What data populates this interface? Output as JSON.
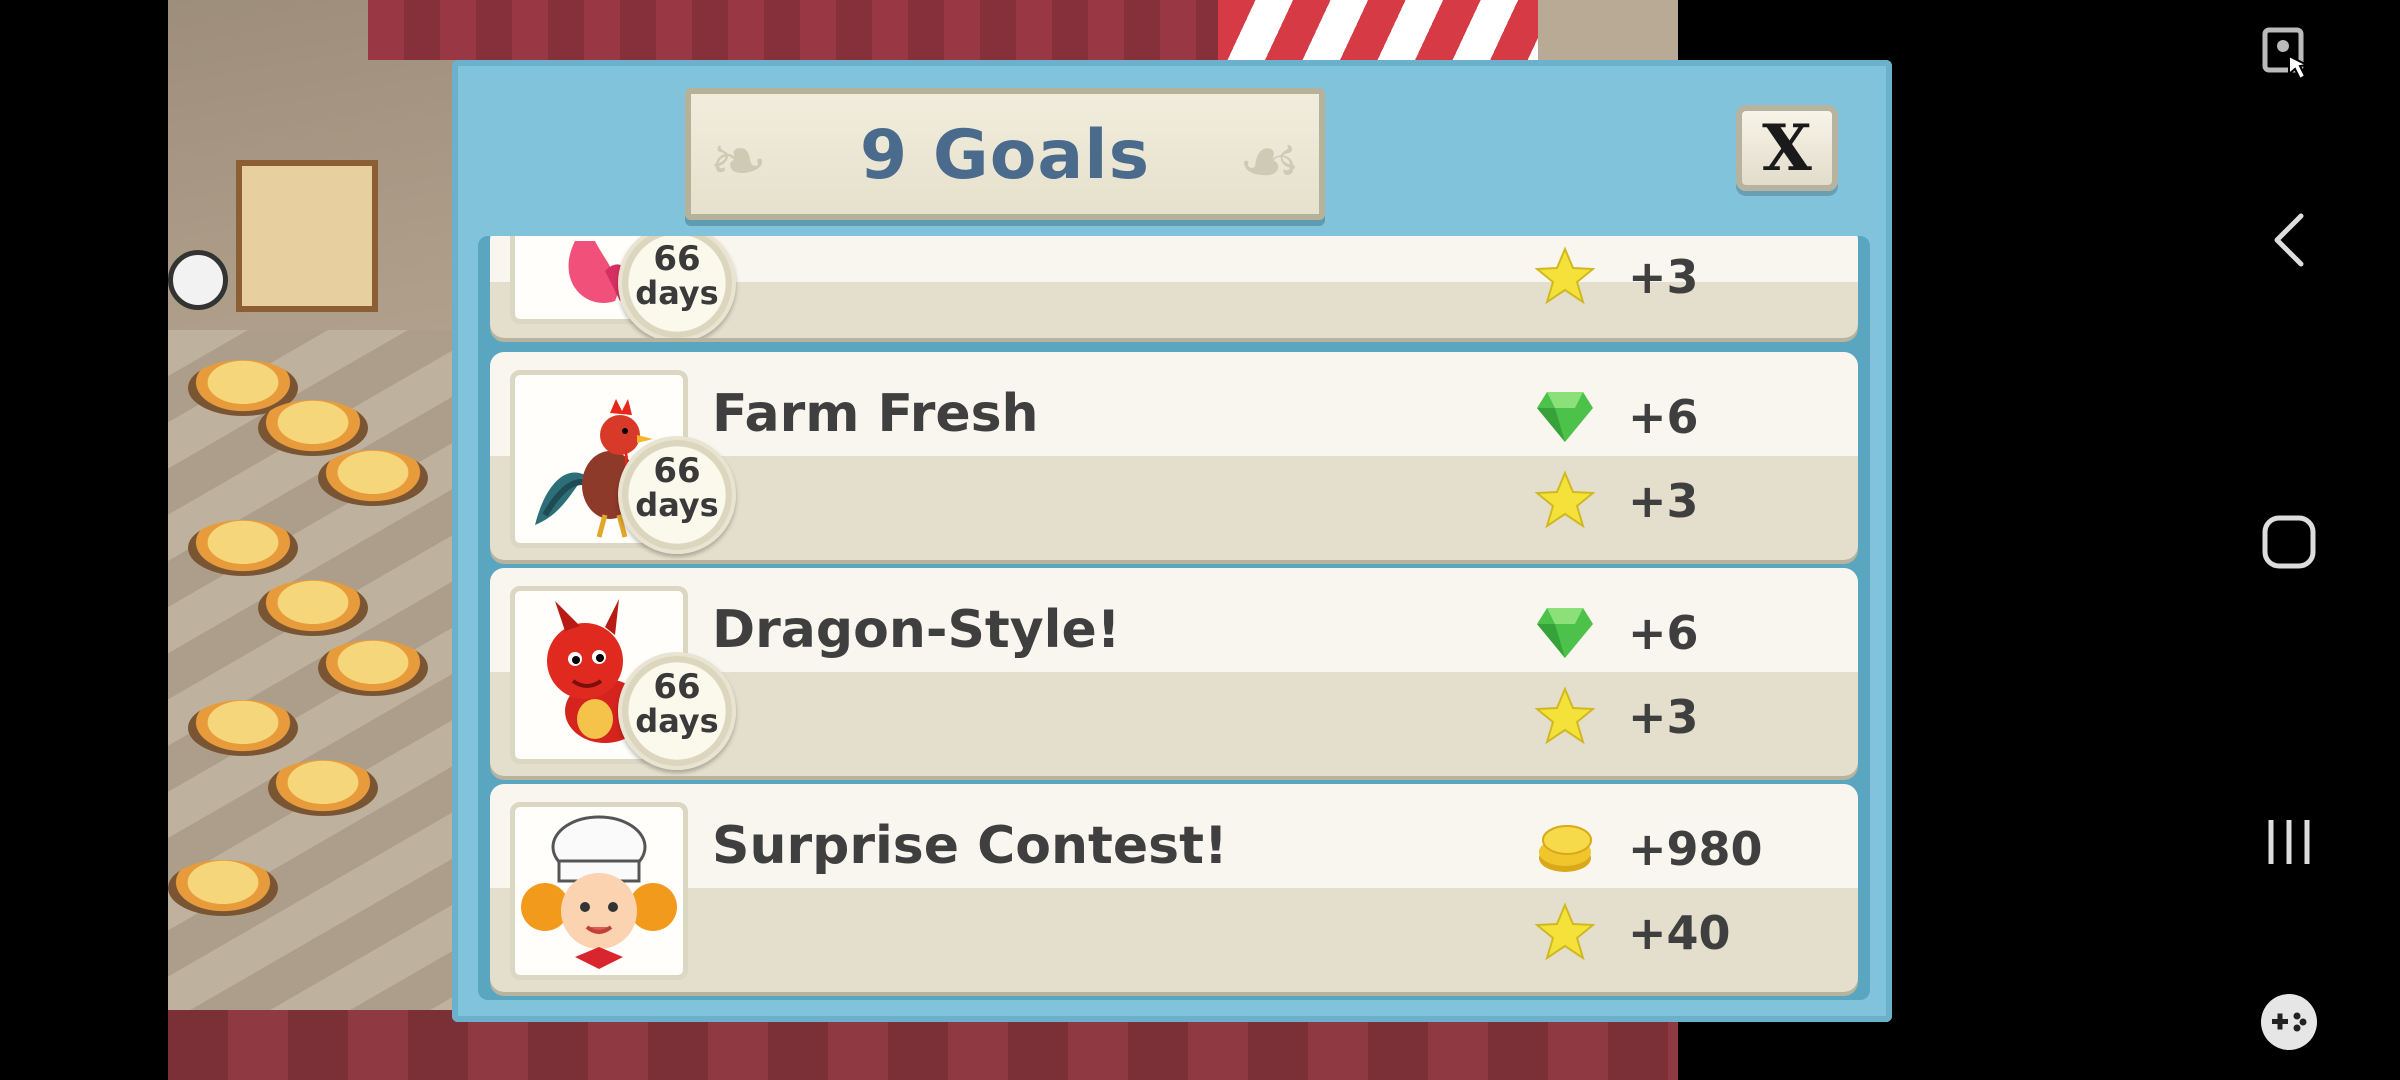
{
  "dialog": {
    "title": "9 Goals",
    "close_label": "X"
  },
  "goals": [
    {
      "title": "",
      "timer_value": "66",
      "timer_unit": "days",
      "rewards": [
        {
          "icon": "star-icon",
          "value": "+3"
        }
      ]
    },
    {
      "title": "Farm Fresh",
      "timer_value": "66",
      "timer_unit": "days",
      "rewards": [
        {
          "icon": "gem-icon",
          "value": "+6"
        },
        {
          "icon": "star-icon",
          "value": "+3"
        }
      ]
    },
    {
      "title": "Dragon-Style!",
      "timer_value": "66",
      "timer_unit": "days",
      "rewards": [
        {
          "icon": "gem-icon",
          "value": "+6"
        },
        {
          "icon": "star-icon",
          "value": "+3"
        }
      ]
    },
    {
      "title": "Surprise Contest!",
      "rewards": [
        {
          "icon": "coins-icon",
          "value": "+980"
        },
        {
          "icon": "star-icon",
          "value": "+40"
        }
      ]
    }
  ],
  "colors": {
    "dialog_bg": "#80c3da",
    "title_text": "#4a6b8c",
    "star": "#f4e23a",
    "gem": "#4cc24a",
    "coin": "#f1c62c"
  },
  "navbar": {
    "icons": [
      "screenshot-edit-icon",
      "back-icon",
      "home-icon",
      "recents-icon",
      "game-tools-icon"
    ]
  }
}
